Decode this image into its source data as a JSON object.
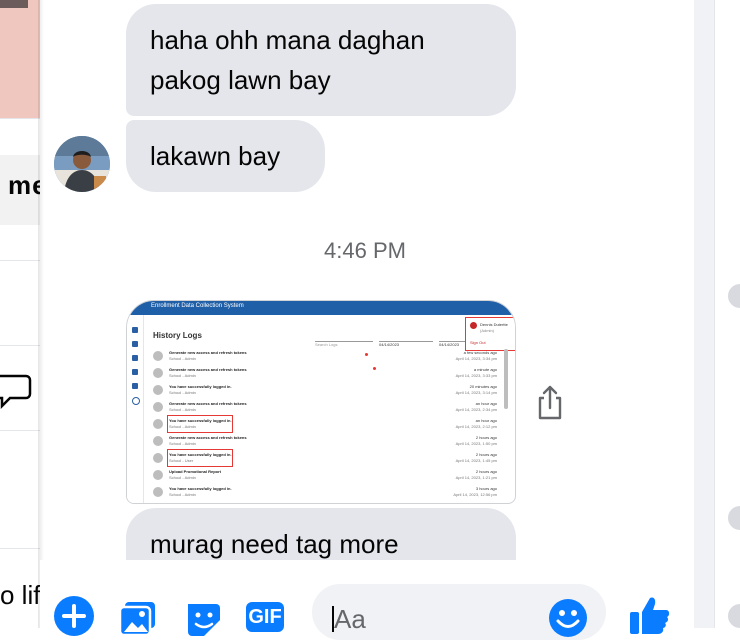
{
  "left_partial": {
    "text_me": "me",
    "text_lif": "o lif"
  },
  "messages": [
    {
      "line1": "haha ohh mana daghan",
      "line2": "pakog lawn bay"
    },
    {
      "text": "lakawn bay"
    }
  ],
  "timestamp": "4:46 PM",
  "attachment": {
    "app_title": "Enrollment Data Collection System",
    "heading": "History Logs",
    "filters": [
      "Search Logs",
      "04/14/2023",
      "04/14/2023"
    ],
    "user_name": "Dennis Dutertte",
    "user_role": "(Admin)",
    "sign_out": "Sign Out",
    "rows": [
      {
        "title": "Generate new access and refresh tokens",
        "sub": "School - Admin",
        "time": "a few seconds ago",
        "date": "April 14, 2023, 3:34 pm"
      },
      {
        "title": "Generate new access and refresh tokens",
        "sub": "School - Admin",
        "time": "a minute ago",
        "date": "April 14, 2023, 3:33 pm"
      },
      {
        "title": "You have successfully logged in.",
        "sub": "School - Admin",
        "time": "20 minutes ago",
        "date": "April 14, 2023, 3:14 pm"
      },
      {
        "title": "Generate new access and refresh tokens",
        "sub": "School - Admin",
        "time": "an hour ago",
        "date": "April 14, 2023, 2:34 pm"
      },
      {
        "title": "You have successfully logged in.",
        "sub": "School - Admin",
        "time": "an hour ago",
        "date": "April 14, 2023, 2:12 pm"
      },
      {
        "title": "Generate new access and refresh tokens",
        "sub": "School - Admin",
        "time": "2 hours ago",
        "date": "April 14, 2023, 1:50 pm"
      },
      {
        "title": "You have successfully logged in.",
        "sub": "School - User",
        "time": "2 hours ago",
        "date": "April 14, 2023, 1:45 pm"
      },
      {
        "title": "Upload Promotional Report",
        "sub": "School - Admin",
        "time": "2 hours ago",
        "date": "April 14, 2023, 1:21 pm"
      },
      {
        "title": "You have successfully logged in.",
        "sub": "School - Admin",
        "time": "3 hours ago",
        "date": "April 14, 2023, 12:56 pm"
      }
    ]
  },
  "last_message": {
    "text": "murag need tag more"
  },
  "composer": {
    "placeholder": "Aa",
    "icons": [
      "plus-icon",
      "photo-icon",
      "sticker-icon",
      "gif-icon",
      "emoji-icon",
      "thumbs-up-icon"
    ],
    "gif_label": "GIF"
  },
  "colors": {
    "accent": "#0a7cff",
    "bubble": "#e4e6eb",
    "text": "#050505",
    "muted": "#65676b"
  }
}
